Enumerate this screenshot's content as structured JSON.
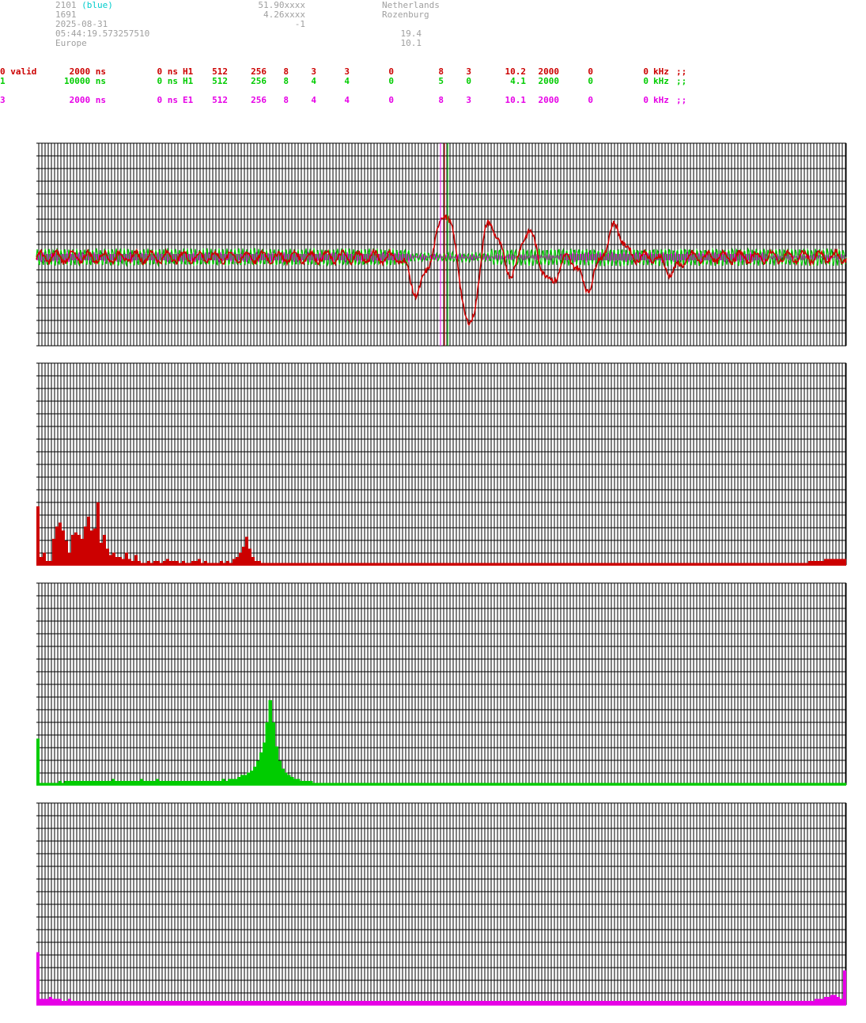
{
  "colors": {
    "red": "#cc0000",
    "green": "#00cc00",
    "magenta": "#e600e6",
    "cyan": "#00cccc",
    "gray": "#a0a0a0",
    "grid": "#000000"
  },
  "header": {
    "col1": [
      "2101",
      "1691",
      "2025-08-31",
      "05:44:19.573257510",
      "Europe"
    ],
    "col1_tag": "(blue)",
    "col2": [
      "51.90xxxx",
      "4.26xxxx",
      "-1"
    ],
    "col3": [
      "Netherlands",
      "Rozenburg"
    ],
    "col4": [
      "19.4",
      "10.1"
    ]
  },
  "channels": [
    {
      "id": "0 valid",
      "resolution": "2000 ns",
      "offset": "0 ns",
      "type": "H1",
      "p1": "512",
      "p2": "256",
      "p3": "8",
      "p4": "3",
      "p5": "3",
      "p6": "0",
      "p7": "8",
      "p8": "3",
      "freq": "10.2",
      "p9": "2000",
      "p10": "0",
      "p11": "0",
      "unit": "kHz",
      "end": ";;"
    },
    {
      "id": "1",
      "resolution": "10000 ns",
      "offset": "0 ns",
      "type": "H1",
      "p1": "512",
      "p2": "256",
      "p3": "8",
      "p4": "4",
      "p5": "4",
      "p6": "0",
      "p7": "5",
      "p8": "0",
      "freq": "4.1",
      "p9": "2000",
      "p10": "0",
      "p11": "0",
      "unit": "kHz",
      "end": ";;"
    },
    {
      "id": "3",
      "resolution": "2000 ns",
      "offset": "0 ns",
      "type": "E1",
      "p1": "512",
      "p2": "256",
      "p3": "8",
      "p4": "4",
      "p5": "4",
      "p6": "0",
      "p7": "8",
      "p8": "3",
      "freq": "10.1",
      "p9": "2000",
      "p10": "0",
      "p11": "0",
      "unit": "kHz",
      "end": ";;"
    }
  ],
  "chart_data": [
    {
      "type": "line",
      "grid": true,
      "ylim": [
        -1,
        1
      ],
      "xlim": [
        0,
        1
      ],
      "markers": [
        {
          "x": 0.499,
          "color": "#e600e6"
        },
        {
          "x": 0.504,
          "color": "#cc0000"
        },
        {
          "x": 0.508,
          "color": "#00cc00"
        }
      ],
      "series": [
        {
          "color": "#cc0000",
          "pulses": [
            [
              0.47,
              -0.35
            ],
            [
              0.505,
              0.45
            ],
            [
              0.535,
              -0.7
            ],
            [
              0.56,
              0.35
            ],
            [
              0.59,
              -0.2
            ],
            [
              0.605,
              0.3
            ],
            [
              0.635,
              -0.25
            ],
            [
              0.68,
              -0.3
            ],
            [
              0.715,
              0.3
            ],
            [
              0.785,
              -0.15
            ]
          ],
          "noise": 0.05
        },
        {
          "color": "#00cc00",
          "freq": 205,
          "amp": 0.08,
          "noise": 0.02
        },
        {
          "color": "#e600e6",
          "freq": 480,
          "amp": 0.05,
          "band_x": [
            0.0,
            0.46,
            0.65,
            0.9
          ]
        }
      ]
    },
    {
      "type": "bar",
      "grid": true,
      "ylim": [
        0,
        1
      ],
      "series": [
        {
          "color": "#cc0000",
          "values": [
            0.29,
            0.04,
            0.06,
            0.02,
            0.02,
            0.13,
            0.19,
            0.21,
            0.17,
            0.12,
            0.06,
            0.15,
            0.16,
            0.15,
            0.13,
            0.19,
            0.24,
            0.17,
            0.18,
            0.31,
            0.11,
            0.15,
            0.08,
            0.05,
            0.06,
            0.04,
            0.04,
            0.03,
            0.06,
            0.03,
            0.02,
            0.05,
            0.02,
            0.01,
            0.01,
            0.02,
            0.01,
            0.02,
            0.02,
            0.01,
            0.02,
            0.03,
            0.02,
            0.02,
            0.02,
            0.01,
            0.02,
            0.01,
            0.01,
            0.02,
            0.02,
            0.03,
            0.01,
            0.02,
            0.01,
            0.01,
            0.01,
            0.01,
            0.02,
            0.01,
            0.02,
            0.01,
            0.03,
            0.04,
            0.06,
            0.09,
            0.14,
            0.08,
            0.04,
            0.02,
            0.02,
            0.01,
            0.01,
            0.01,
            0.01,
            0.01,
            0.01,
            0.01,
            0.01,
            0.01,
            0.01,
            0.01,
            0.01,
            0.01,
            0.01,
            0.01,
            0.01,
            0.01,
            0.01,
            0.01,
            0.01,
            0.01,
            0.01,
            0.01,
            0.01,
            0.01,
            0.01,
            0.01,
            0.01,
            0.01,
            0.01,
            0.01,
            0.01,
            0.01,
            0.01,
            0.01,
            0.01,
            0.01,
            0.01,
            0.01,
            0.01,
            0.01,
            0.01,
            0.01,
            0.01,
            0.01,
            0.01,
            0.01,
            0.01,
            0.01,
            0.01,
            0.01,
            0.01,
            0.01,
            0.01,
            0.01,
            0.01,
            0.01,
            0.01,
            0.01,
            0.01,
            0.01,
            0.01,
            0.01,
            0.01,
            0.01,
            0.01,
            0.01,
            0.01,
            0.01,
            0.01,
            0.01,
            0.01,
            0.01,
            0.01,
            0.01,
            0.01,
            0.01,
            0.01,
            0.01,
            0.01,
            0.01,
            0.01,
            0.01,
            0.01,
            0.01,
            0.01,
            0.01,
            0.01,
            0.01,
            0.01,
            0.01,
            0.01,
            0.01,
            0.01,
            0.01,
            0.01,
            0.01,
            0.01,
            0.01,
            0.01,
            0.01,
            0.01,
            0.01,
            0.01,
            0.01,
            0.01,
            0.01,
            0.01,
            0.01,
            0.01,
            0.01,
            0.01,
            0.01,
            0.01,
            0.01,
            0.01,
            0.01,
            0.01,
            0.01,
            0.01,
            0.01,
            0.01,
            0.01,
            0.01,
            0.01,
            0.01,
            0.01,
            0.01,
            0.01,
            0.01,
            0.01,
            0.01,
            0.01,
            0.01,
            0.01,
            0.01,
            0.01,
            0.01,
            0.01,
            0.01,
            0.01,
            0.01,
            0.01,
            0.01,
            0.01,
            0.01,
            0.01,
            0.01,
            0.01,
            0.01,
            0.01,
            0.01,
            0.01,
            0.01,
            0.01,
            0.01,
            0.01,
            0.01,
            0.01,
            0.01,
            0.01,
            0.01,
            0.01,
            0.01,
            0.01,
            0.01,
            0.01,
            0.01,
            0.01,
            0.01,
            0.01,
            0.01,
            0.01,
            0.02,
            0.02,
            0.02,
            0.02,
            0.02,
            0.03,
            0.03,
            0.03,
            0.03,
            0.03,
            0.03,
            0.03
          ]
        }
      ]
    },
    {
      "type": "bar",
      "grid": true,
      "ylim": [
        0,
        1
      ],
      "series": [
        {
          "color": "#00cc00",
          "values": [
            0.23,
            0.01,
            0.01,
            0.01,
            0.01,
            0.01,
            0.01,
            0.02,
            0.01,
            0.02,
            0.02,
            0.02,
            0.02,
            0.02,
            0.02,
            0.02,
            0.02,
            0.02,
            0.02,
            0.02,
            0.02,
            0.02,
            0.02,
            0.02,
            0.03,
            0.02,
            0.02,
            0.02,
            0.02,
            0.02,
            0.02,
            0.02,
            0.02,
            0.03,
            0.02,
            0.02,
            0.02,
            0.02,
            0.03,
            0.02,
            0.02,
            0.02,
            0.02,
            0.02,
            0.02,
            0.02,
            0.02,
            0.02,
            0.02,
            0.02,
            0.02,
            0.02,
            0.02,
            0.02,
            0.02,
            0.02,
            0.02,
            0.02,
            0.02,
            0.03,
            0.02,
            0.03,
            0.03,
            0.03,
            0.04,
            0.05,
            0.05,
            0.06,
            0.07,
            0.09,
            0.12,
            0.16,
            0.21,
            0.31,
            0.42,
            0.31,
            0.19,
            0.12,
            0.08,
            0.06,
            0.05,
            0.04,
            0.03,
            0.03,
            0.02,
            0.02,
            0.02,
            0.02,
            0.01,
            0.01,
            0.01,
            0.01,
            0.01,
            0.01,
            0.01,
            0.01,
            0.01,
            0.01,
            0.01,
            0.01,
            0.01,
            0.01,
            0.01,
            0.01,
            0.01,
            0.01,
            0.01,
            0.01,
            0.01,
            0.01,
            0.01,
            0.01,
            0.01,
            0.01,
            0.01,
            0.01,
            0.01,
            0.01,
            0.01,
            0.01,
            0.01,
            0.01,
            0.01,
            0.01,
            0.01,
            0.01,
            0.01,
            0.01,
            0.01,
            0.01,
            0.01,
            0.01,
            0.01,
            0.01,
            0.01,
            0.01,
            0.01,
            0.01,
            0.01,
            0.01,
            0.01,
            0.01,
            0.01,
            0.01,
            0.01,
            0.01,
            0.01,
            0.01,
            0.01,
            0.01,
            0.01,
            0.01,
            0.01,
            0.01,
            0.01,
            0.01,
            0.01,
            0.01,
            0.01,
            0.01,
            0.01,
            0.01,
            0.01,
            0.01,
            0.01,
            0.01,
            0.01,
            0.01,
            0.01,
            0.01,
            0.01,
            0.01,
            0.01,
            0.01,
            0.01,
            0.01,
            0.01,
            0.01,
            0.01,
            0.01,
            0.01,
            0.01,
            0.01,
            0.01,
            0.01,
            0.01,
            0.01,
            0.01,
            0.01,
            0.01,
            0.01,
            0.01,
            0.01,
            0.01,
            0.01,
            0.01,
            0.01,
            0.01,
            0.01,
            0.01,
            0.01,
            0.01,
            0.01,
            0.01,
            0.01,
            0.01,
            0.01,
            0.01,
            0.01,
            0.01,
            0.01,
            0.01,
            0.01,
            0.01,
            0.01,
            0.01,
            0.01,
            0.01,
            0.01,
            0.01,
            0.01,
            0.01,
            0.01,
            0.01,
            0.01,
            0.01,
            0.01,
            0.01,
            0.01,
            0.01,
            0.01,
            0.01,
            0.01,
            0.01,
            0.01,
            0.01,
            0.01,
            0.01,
            0.01,
            0.01,
            0.01,
            0.01,
            0.01,
            0.01,
            0.01,
            0.01,
            0.01,
            0.01,
            0.01,
            0.01,
            0.01,
            0.01,
            0.01,
            0.01,
            0.01,
            0.01,
            0.01,
            0.01
          ]
        }
      ]
    },
    {
      "type": "bar",
      "grid": true,
      "ylim": [
        0,
        1
      ],
      "series": [
        {
          "color": "#e600e6",
          "values": [
            0.26,
            0.03,
            0.03,
            0.03,
            0.04,
            0.03,
            0.03,
            0.03,
            0.02,
            0.02,
            0.03,
            0.02,
            0.02,
            0.02,
            0.02,
            0.02,
            0.02,
            0.02,
            0.02,
            0.02,
            0.02,
            0.02,
            0.02,
            0.02,
            0.02,
            0.02,
            0.02,
            0.02,
            0.02,
            0.02,
            0.02,
            0.02,
            0.02,
            0.02,
            0.02,
            0.02,
            0.02,
            0.02,
            0.02,
            0.02,
            0.02,
            0.02,
            0.02,
            0.02,
            0.02,
            0.02,
            0.02,
            0.02,
            0.02,
            0.02,
            0.02,
            0.02,
            0.02,
            0.02,
            0.02,
            0.02,
            0.02,
            0.02,
            0.02,
            0.02,
            0.02,
            0.02,
            0.02,
            0.02,
            0.02,
            0.02,
            0.02,
            0.02,
            0.02,
            0.02,
            0.02,
            0.02,
            0.02,
            0.02,
            0.02,
            0.02,
            0.02,
            0.02,
            0.02,
            0.02,
            0.02,
            0.02,
            0.02,
            0.02,
            0.02,
            0.02,
            0.02,
            0.02,
            0.02,
            0.02,
            0.02,
            0.02,
            0.02,
            0.02,
            0.02,
            0.02,
            0.02,
            0.02,
            0.02,
            0.02,
            0.02,
            0.02,
            0.02,
            0.02,
            0.02,
            0.02,
            0.02,
            0.02,
            0.02,
            0.02,
            0.02,
            0.02,
            0.02,
            0.02,
            0.02,
            0.02,
            0.02,
            0.02,
            0.02,
            0.02,
            0.02,
            0.02,
            0.02,
            0.02,
            0.02,
            0.02,
            0.02,
            0.02,
            0.02,
            0.02,
            0.02,
            0.02,
            0.02,
            0.02,
            0.02,
            0.02,
            0.02,
            0.02,
            0.02,
            0.02,
            0.02,
            0.02,
            0.02,
            0.02,
            0.02,
            0.02,
            0.02,
            0.02,
            0.02,
            0.02,
            0.02,
            0.02,
            0.02,
            0.02,
            0.02,
            0.02,
            0.02,
            0.02,
            0.02,
            0.02,
            0.02,
            0.02,
            0.02,
            0.02,
            0.02,
            0.02,
            0.02,
            0.02,
            0.02,
            0.02,
            0.02,
            0.02,
            0.02,
            0.02,
            0.02,
            0.02,
            0.02,
            0.02,
            0.02,
            0.02,
            0.02,
            0.02,
            0.02,
            0.02,
            0.02,
            0.02,
            0.02,
            0.02,
            0.02,
            0.02,
            0.02,
            0.02,
            0.02,
            0.02,
            0.02,
            0.02,
            0.02,
            0.02,
            0.02,
            0.02,
            0.02,
            0.02,
            0.02,
            0.02,
            0.02,
            0.02,
            0.02,
            0.02,
            0.02,
            0.02,
            0.02,
            0.02,
            0.02,
            0.02,
            0.02,
            0.02,
            0.02,
            0.02,
            0.02,
            0.02,
            0.02,
            0.02,
            0.02,
            0.02,
            0.02,
            0.02,
            0.02,
            0.02,
            0.02,
            0.02,
            0.02,
            0.02,
            0.02,
            0.02,
            0.02,
            0.02,
            0.02,
            0.02,
            0.02,
            0.02,
            0.02,
            0.02,
            0.02,
            0.02,
            0.02,
            0.02,
            0.03,
            0.03,
            0.03,
            0.04,
            0.04,
            0.05,
            0.05,
            0.04,
            0.03,
            0.17
          ]
        }
      ]
    }
  ]
}
